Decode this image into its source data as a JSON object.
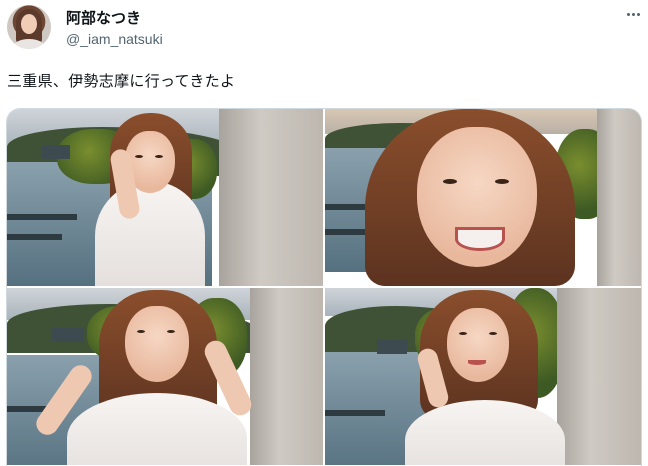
{
  "user": {
    "display_name": "阿部なつき",
    "handle": "@_iam_natsuki"
  },
  "tweet": {
    "text": "三重県、伊勢志摩に行ってきたよ"
  },
  "media": [
    {
      "pose": "hand-on-cheek"
    },
    {
      "pose": "smiling-selfie"
    },
    {
      "pose": "hair-mustache"
    },
    {
      "pose": "holding-hair"
    }
  ],
  "icons": {
    "more": "more-horizontal-icon"
  },
  "colors": {
    "text_primary": "#0f1419",
    "text_secondary": "#536471",
    "border": "#cfd9de"
  }
}
